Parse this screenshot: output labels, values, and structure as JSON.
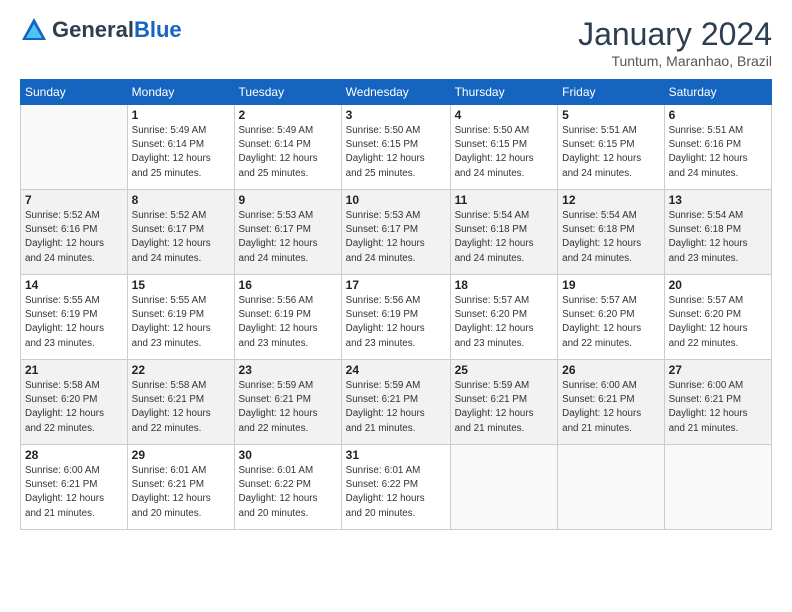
{
  "header": {
    "logo_line1": "General",
    "logo_line2": "Blue",
    "month": "January 2024",
    "location": "Tuntum, Maranhao, Brazil"
  },
  "weekdays": [
    "Sunday",
    "Monday",
    "Tuesday",
    "Wednesday",
    "Thursday",
    "Friday",
    "Saturday"
  ],
  "weeks": [
    [
      {
        "date": "",
        "info": ""
      },
      {
        "date": "1",
        "info": "Sunrise: 5:49 AM\nSunset: 6:14 PM\nDaylight: 12 hours\nand 25 minutes."
      },
      {
        "date": "2",
        "info": "Sunrise: 5:49 AM\nSunset: 6:14 PM\nDaylight: 12 hours\nand 25 minutes."
      },
      {
        "date": "3",
        "info": "Sunrise: 5:50 AM\nSunset: 6:15 PM\nDaylight: 12 hours\nand 25 minutes."
      },
      {
        "date": "4",
        "info": "Sunrise: 5:50 AM\nSunset: 6:15 PM\nDaylight: 12 hours\nand 24 minutes."
      },
      {
        "date": "5",
        "info": "Sunrise: 5:51 AM\nSunset: 6:15 PM\nDaylight: 12 hours\nand 24 minutes."
      },
      {
        "date": "6",
        "info": "Sunrise: 5:51 AM\nSunset: 6:16 PM\nDaylight: 12 hours\nand 24 minutes."
      }
    ],
    [
      {
        "date": "7",
        "info": "Sunrise: 5:52 AM\nSunset: 6:16 PM\nDaylight: 12 hours\nand 24 minutes."
      },
      {
        "date": "8",
        "info": "Sunrise: 5:52 AM\nSunset: 6:17 PM\nDaylight: 12 hours\nand 24 minutes."
      },
      {
        "date": "9",
        "info": "Sunrise: 5:53 AM\nSunset: 6:17 PM\nDaylight: 12 hours\nand 24 minutes."
      },
      {
        "date": "10",
        "info": "Sunrise: 5:53 AM\nSunset: 6:17 PM\nDaylight: 12 hours\nand 24 minutes."
      },
      {
        "date": "11",
        "info": "Sunrise: 5:54 AM\nSunset: 6:18 PM\nDaylight: 12 hours\nand 24 minutes."
      },
      {
        "date": "12",
        "info": "Sunrise: 5:54 AM\nSunset: 6:18 PM\nDaylight: 12 hours\nand 24 minutes."
      },
      {
        "date": "13",
        "info": "Sunrise: 5:54 AM\nSunset: 6:18 PM\nDaylight: 12 hours\nand 23 minutes."
      }
    ],
    [
      {
        "date": "14",
        "info": "Sunrise: 5:55 AM\nSunset: 6:19 PM\nDaylight: 12 hours\nand 23 minutes."
      },
      {
        "date": "15",
        "info": "Sunrise: 5:55 AM\nSunset: 6:19 PM\nDaylight: 12 hours\nand 23 minutes."
      },
      {
        "date": "16",
        "info": "Sunrise: 5:56 AM\nSunset: 6:19 PM\nDaylight: 12 hours\nand 23 minutes."
      },
      {
        "date": "17",
        "info": "Sunrise: 5:56 AM\nSunset: 6:19 PM\nDaylight: 12 hours\nand 23 minutes."
      },
      {
        "date": "18",
        "info": "Sunrise: 5:57 AM\nSunset: 6:20 PM\nDaylight: 12 hours\nand 23 minutes."
      },
      {
        "date": "19",
        "info": "Sunrise: 5:57 AM\nSunset: 6:20 PM\nDaylight: 12 hours\nand 22 minutes."
      },
      {
        "date": "20",
        "info": "Sunrise: 5:57 AM\nSunset: 6:20 PM\nDaylight: 12 hours\nand 22 minutes."
      }
    ],
    [
      {
        "date": "21",
        "info": "Sunrise: 5:58 AM\nSunset: 6:20 PM\nDaylight: 12 hours\nand 22 minutes."
      },
      {
        "date": "22",
        "info": "Sunrise: 5:58 AM\nSunset: 6:21 PM\nDaylight: 12 hours\nand 22 minutes."
      },
      {
        "date": "23",
        "info": "Sunrise: 5:59 AM\nSunset: 6:21 PM\nDaylight: 12 hours\nand 22 minutes."
      },
      {
        "date": "24",
        "info": "Sunrise: 5:59 AM\nSunset: 6:21 PM\nDaylight: 12 hours\nand 21 minutes."
      },
      {
        "date": "25",
        "info": "Sunrise: 5:59 AM\nSunset: 6:21 PM\nDaylight: 12 hours\nand 21 minutes."
      },
      {
        "date": "26",
        "info": "Sunrise: 6:00 AM\nSunset: 6:21 PM\nDaylight: 12 hours\nand 21 minutes."
      },
      {
        "date": "27",
        "info": "Sunrise: 6:00 AM\nSunset: 6:21 PM\nDaylight: 12 hours\nand 21 minutes."
      }
    ],
    [
      {
        "date": "28",
        "info": "Sunrise: 6:00 AM\nSunset: 6:21 PM\nDaylight: 12 hours\nand 21 minutes."
      },
      {
        "date": "29",
        "info": "Sunrise: 6:01 AM\nSunset: 6:21 PM\nDaylight: 12 hours\nand 20 minutes."
      },
      {
        "date": "30",
        "info": "Sunrise: 6:01 AM\nSunset: 6:22 PM\nDaylight: 12 hours\nand 20 minutes."
      },
      {
        "date": "31",
        "info": "Sunrise: 6:01 AM\nSunset: 6:22 PM\nDaylight: 12 hours\nand 20 minutes."
      },
      {
        "date": "",
        "info": ""
      },
      {
        "date": "",
        "info": ""
      },
      {
        "date": "",
        "info": ""
      }
    ]
  ]
}
